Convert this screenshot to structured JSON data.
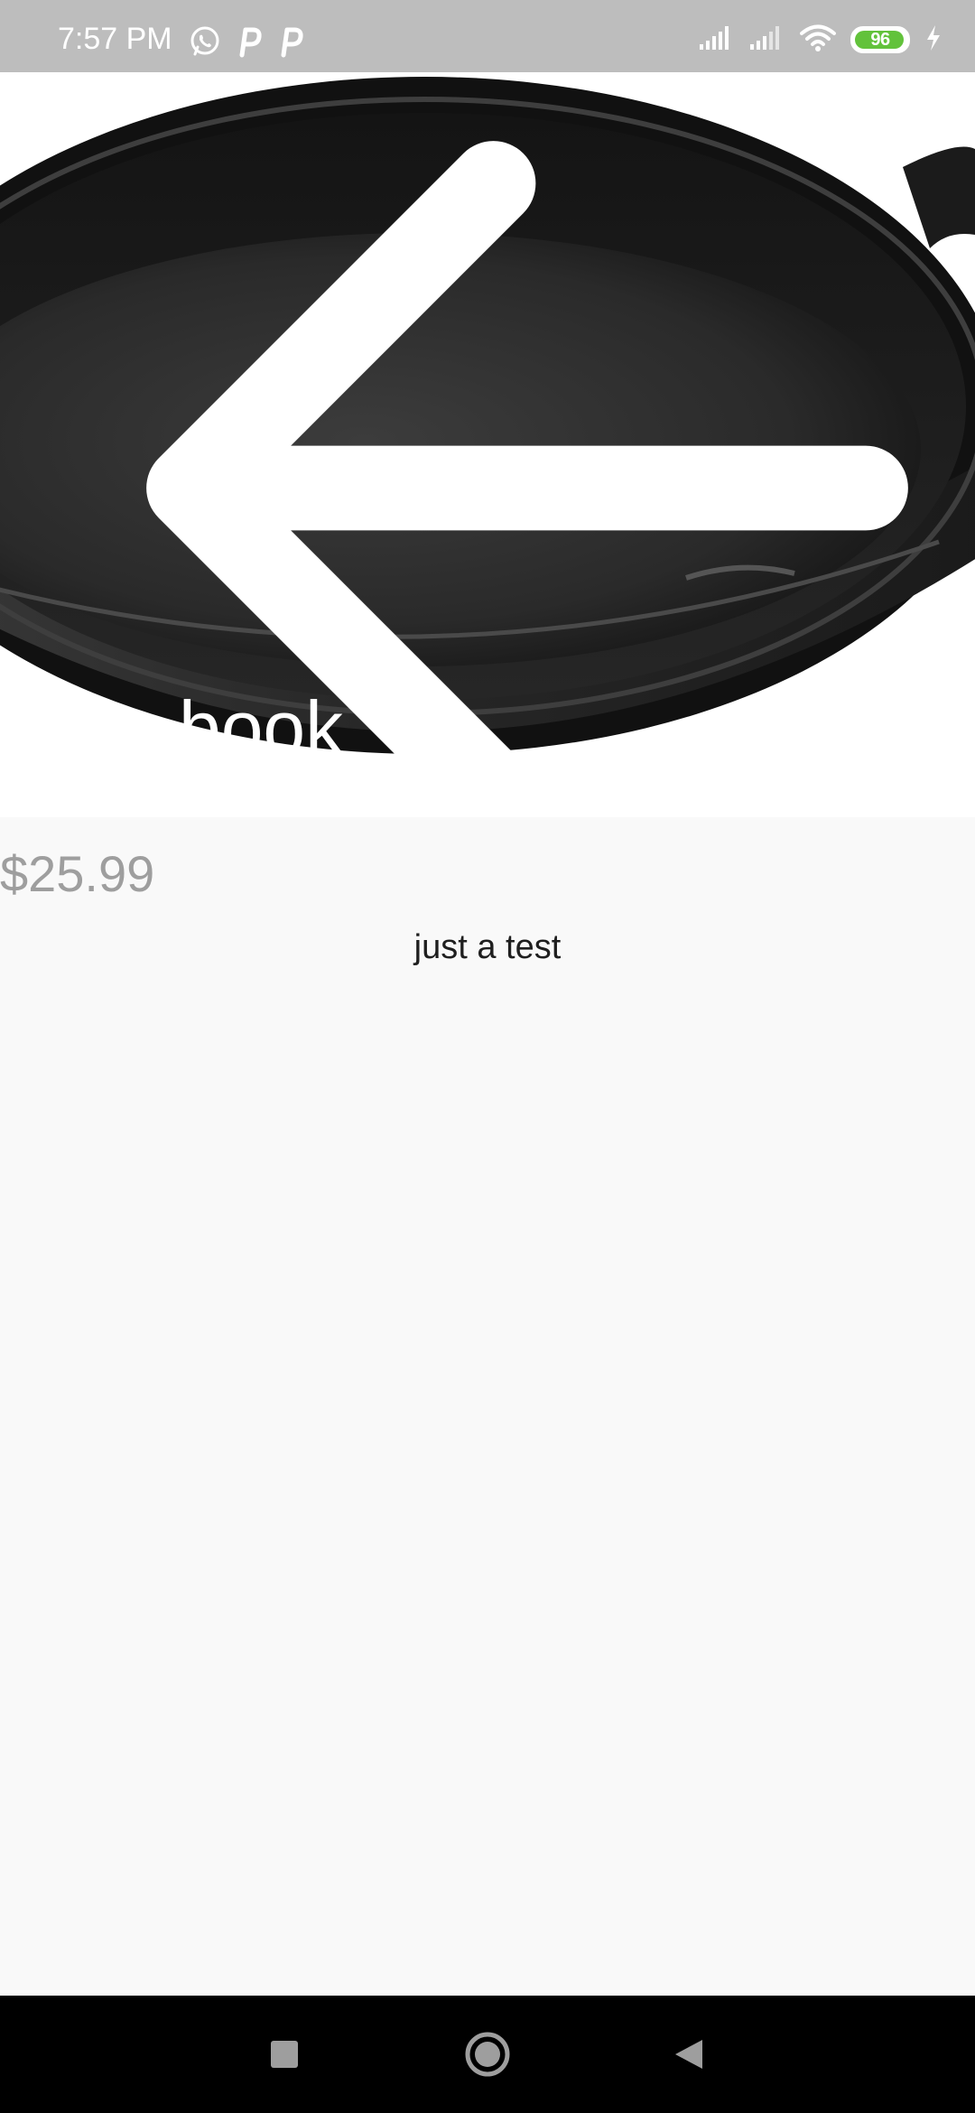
{
  "status_bar": {
    "time": "7:57 PM",
    "left_icons": [
      "whatsapp-icon",
      "parking-icon",
      "parking-icon"
    ],
    "right_icons": [
      "signal-icon",
      "signal-icon",
      "wifi-icon",
      "battery-icon",
      "charging-icon"
    ],
    "battery_level": "96",
    "battery_fraction": 0.96,
    "battery_color": "#62c23b"
  },
  "header": {
    "back_icon": "arrow-left-icon",
    "title": "book"
  },
  "product": {
    "price": "$25.99",
    "description": "just a test"
  },
  "nav_bar": {
    "recents_icon": "square-icon",
    "home_icon": "circle-icon",
    "back_icon": "triangle-back-icon"
  }
}
